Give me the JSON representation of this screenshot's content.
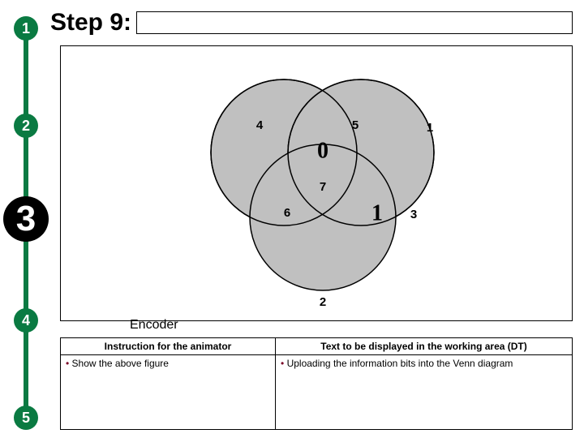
{
  "domain": "Document",
  "header": {
    "title": "Step 9:",
    "title_box_value": ""
  },
  "rail": {
    "steps": [
      "1",
      "2",
      "3",
      "4",
      "5"
    ],
    "current_index": 2
  },
  "venn": {
    "regions": {
      "left": "4",
      "right": "5",
      "top_right_out": "1",
      "center": "0",
      "mid": "7",
      "bottom_left": "6",
      "bottom_right": "1",
      "right_out": "3",
      "bottom": "2"
    }
  },
  "caption": "Encoder",
  "table": {
    "headers": [
      "Instruction for the animator",
      "Text to be displayed in the working area (DT)"
    ],
    "rows": [
      [
        "Show the above figure",
        "Uploading the information bits into the Venn diagram"
      ]
    ]
  },
  "colors": {
    "rail_green": "#0a7a42",
    "circle_grey": "#c0c0c0",
    "bullet_maroon": "#7a0026"
  }
}
